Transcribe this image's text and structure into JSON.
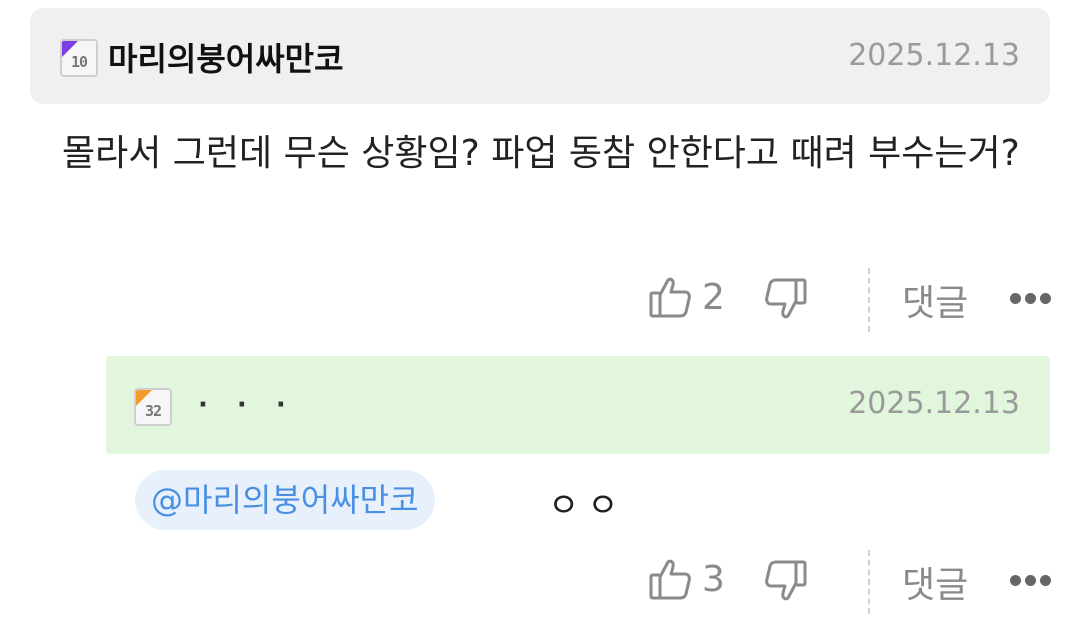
{
  "comment": {
    "level_badge": "10",
    "author": "마리의붕어싸만코",
    "date": "2025.12.13",
    "text": "몰라서 그런데 무슨 상황임? 파업 동참 안한다고 때려 부수는거?",
    "likes": "2",
    "reply_label": "댓글"
  },
  "reply": {
    "level_badge": "32",
    "author": "· · ·",
    "date": "2025.12.13",
    "mention": "@마리의붕어싸만코",
    "text": "ㅇㅇ",
    "likes": "3",
    "reply_label": "댓글"
  },
  "colors": {
    "comment_header_bg": "#f0f0f0",
    "reply_header_bg": "#e2f5dd",
    "mention_text": "#4a90e2",
    "badge10_corner": "#7b3fe4",
    "badge32_corner": "#f39c2b"
  },
  "icons": [
    "level-badge-icon",
    "thumbs-up-icon",
    "thumbs-down-icon",
    "more-icon"
  ]
}
